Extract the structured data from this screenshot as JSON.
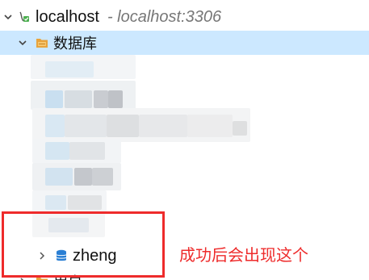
{
  "tree": {
    "connection": {
      "name": "localhost",
      "address": "- localhost:3306",
      "icon": "server-connection-icon",
      "expanded": true
    },
    "databases_folder": {
      "label": "数据库",
      "icon": "folder-icon",
      "expanded": true
    },
    "database_item": {
      "label": "zheng",
      "icon": "database-icon",
      "expanded": false
    },
    "users_folder": {
      "label": "用户",
      "icon": "folder-icon"
    }
  },
  "annotation": {
    "caption": "成功后会出现这个",
    "color": "#ee2b2b"
  },
  "colors": {
    "selection": "#cce8ff",
    "folder": "#e8a33c",
    "database": "#2a7fd4"
  }
}
